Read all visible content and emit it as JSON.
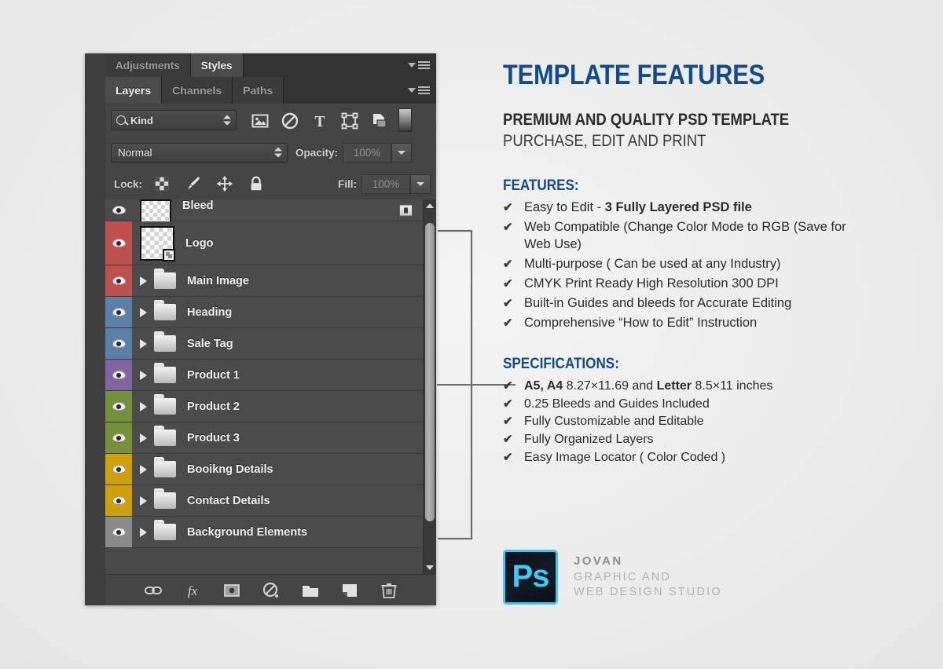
{
  "panel": {
    "top_tabs": [
      {
        "label": "Adjustments",
        "active": false
      },
      {
        "label": "Styles",
        "active": true
      }
    ],
    "main_tabs": [
      {
        "label": "Layers",
        "active": true
      },
      {
        "label": "Channels",
        "active": false
      },
      {
        "label": "Paths",
        "active": false
      }
    ],
    "filter_row": {
      "kind_label": "Kind",
      "icons": [
        "pixel-layer-filter-icon",
        "adjustment-layer-filter-icon",
        "type-layer-filter-icon",
        "shape-layer-filter-icon",
        "smart-object-filter-icon"
      ]
    },
    "blend_row": {
      "blend_mode": "Normal",
      "opacity_label": "Opacity:",
      "opacity_value": "100%"
    },
    "lock_row": {
      "lock_label": "Lock:",
      "lock_icons": [
        "lock-transparent-pixels-icon",
        "lock-image-pixels-icon",
        "lock-position-icon",
        "lock-all-icon"
      ],
      "fill_label": "Fill:",
      "fill_value": "100%"
    },
    "layers": [
      {
        "name": "Bleed",
        "color": "none",
        "type": "thumb",
        "clipped": true
      },
      {
        "name": "Logo",
        "color": "red",
        "type": "smart",
        "clipped": false
      },
      {
        "name": "Main Image",
        "color": "red",
        "type": "folder",
        "clipped": false
      },
      {
        "name": "Heading",
        "color": "blue",
        "type": "folder",
        "clipped": false
      },
      {
        "name": "Sale Tag",
        "color": "blue",
        "type": "folder",
        "clipped": false
      },
      {
        "name": "Product 1",
        "color": "purple",
        "type": "folder",
        "clipped": false
      },
      {
        "name": "Product 2",
        "color": "green",
        "type": "folder",
        "clipped": false
      },
      {
        "name": "Product 3",
        "color": "green",
        "type": "folder",
        "clipped": false
      },
      {
        "name": "Booikng Details",
        "color": "yellow",
        "type": "folder",
        "clipped": false
      },
      {
        "name": "Contact Details",
        "color": "yellow",
        "type": "folder",
        "clipped": false
      },
      {
        "name": "Background Elements",
        "color": "gray",
        "type": "folder",
        "clipped": false
      }
    ],
    "bottom_toolbar": [
      "link-layers-icon",
      "layer-style-fx-icon",
      "add-layer-mask-icon",
      "new-adjustment-layer-icon",
      "new-group-icon",
      "new-layer-icon",
      "delete-layer-icon"
    ],
    "layer_colors": {
      "red": "#c0504d",
      "blue": "#5b80aa",
      "purple": "#8064a2",
      "green": "#75913c",
      "yellow": "#cfa006",
      "gray": "#8a8a8a",
      "none": "#4b4b4b"
    }
  },
  "content": {
    "title": "TEMPLATE FEATURES",
    "subtitle_1": "PREMIUM AND QUALITY PSD TEMPLATE",
    "subtitle_2": "PURCHASE, EDIT AND PRINT",
    "features_heading": "FEATURES:",
    "features": [
      {
        "text": "Easy to Edit - ",
        "bold": "3 Fully Layered PSD file",
        "after": ""
      },
      {
        "text": "Web Compatible (Change Color Mode to RGB (Save for Web Use)",
        "bold": "",
        "after": ""
      },
      {
        "text": "Multi-purpose ( Can be used at any Industry)",
        "bold": "",
        "after": ""
      },
      {
        "text": "CMYK Print Ready High Resolution 300 DPI",
        "bold": "",
        "after": ""
      },
      {
        "text": "Built-in Guides and bleeds for Accurate Editing",
        "bold": "",
        "after": ""
      },
      {
        "text": "Comprehensive “How to Edit” Instruction",
        "bold": "",
        "after": ""
      }
    ],
    "specs_heading": "SPECIFICATIONS:",
    "specs": [
      {
        "text": "",
        "bold": "A5, A4",
        "after": " 8.27×11.69 and ",
        "bold2": "Letter",
        "after2": " 8.5×11 inches"
      },
      {
        "text": "0.25 Bleeds and Guides Included",
        "bold": "",
        "after": ""
      },
      {
        "text": "Fully Customizable and Editable",
        "bold": "",
        "after": ""
      },
      {
        "text": "Fully Organized Layers",
        "bold": "",
        "after": ""
      },
      {
        "text": "Easy Image Locator ( Color Coded )",
        "bold": "",
        "after": ""
      }
    ],
    "check_glyph": "✔"
  },
  "footer": {
    "badge_text": "Ps",
    "brand_name": "JOVAN",
    "brand_line_1": "GRAPHIC AND",
    "brand_line_2": "WEB DESIGN STUDIO"
  },
  "colors": {
    "accent_blue": "#134a8e",
    "badge_cyan": "#3fcbf7",
    "panel_bg": "#4a4a4a"
  }
}
